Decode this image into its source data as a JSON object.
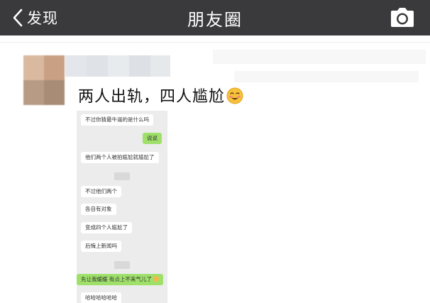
{
  "header": {
    "back_label": "发现",
    "title": "朋友圈",
    "back_icon": "chevron-left-icon",
    "camera_icon": "camera-icon",
    "bar_color": "#3a3a3c"
  },
  "post": {
    "text": "两人出轨，四人尴尬",
    "emoji": "blushing-smile-emoji",
    "chat": {
      "messages": [
        {
          "side": "left",
          "text": "不过你猜最牛逼的是什么吗"
        },
        {
          "side": "right",
          "text": "说说"
        },
        {
          "side": "left",
          "text": "他们两个人被拍尴尬就尴尬了"
        },
        {
          "side": "left",
          "text": "不过他们两个"
        },
        {
          "side": "left",
          "text": "各自有对象"
        },
        {
          "side": "left",
          "text": "变成四个人尴尬了"
        },
        {
          "side": "left",
          "text": "后悔上新闻吗"
        },
        {
          "side": "left",
          "text": "先让我缓缓 有点上不来气儿了"
        },
        {
          "side": "left",
          "text": "哈哈哈哈哈哈"
        }
      ],
      "timestamp_label": "",
      "colors": {
        "background": "#ececec",
        "incoming": "#ffffff",
        "outgoing": "#9fe06a"
      }
    }
  }
}
